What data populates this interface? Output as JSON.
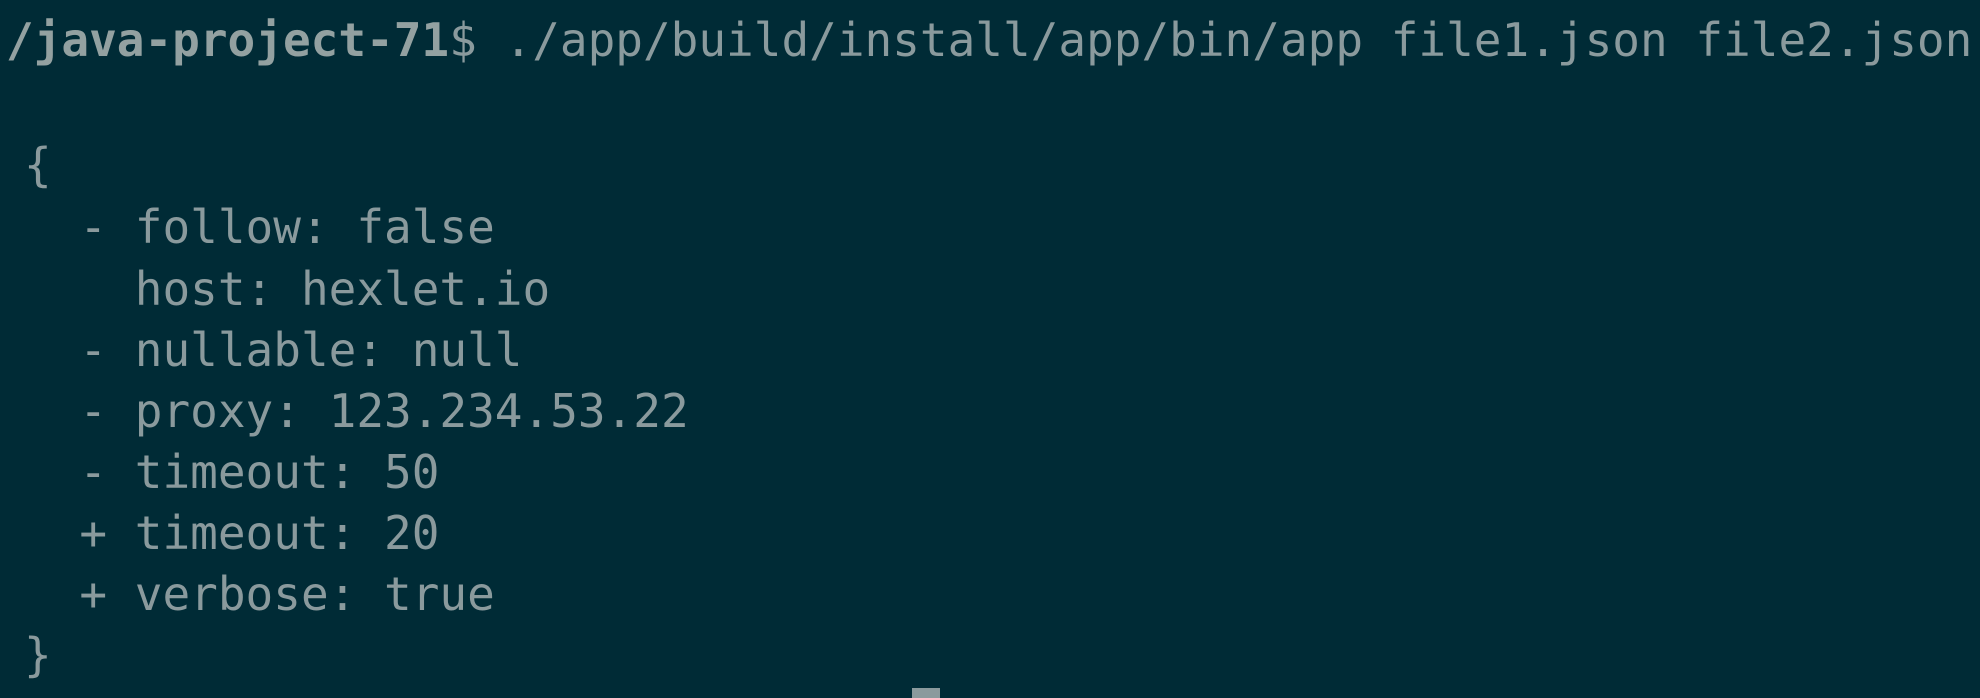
{
  "terminal": {
    "prompt_path": "/java-project-71",
    "prompt_symbol": "$",
    "command": " ./app/build/install/app/bin/app file1.json file2.json",
    "output": [
      "{",
      "  - follow: false",
      "    host: hexlet.io",
      "  - nullable: null",
      "  - proxy: 123.234.53.22",
      "  - timeout: 50",
      "  + timeout: 20",
      "  + verbose: true",
      "}"
    ]
  },
  "colors": {
    "background": "#002b36",
    "text": "#8a9a9d",
    "prompt": "#93a1a1"
  }
}
